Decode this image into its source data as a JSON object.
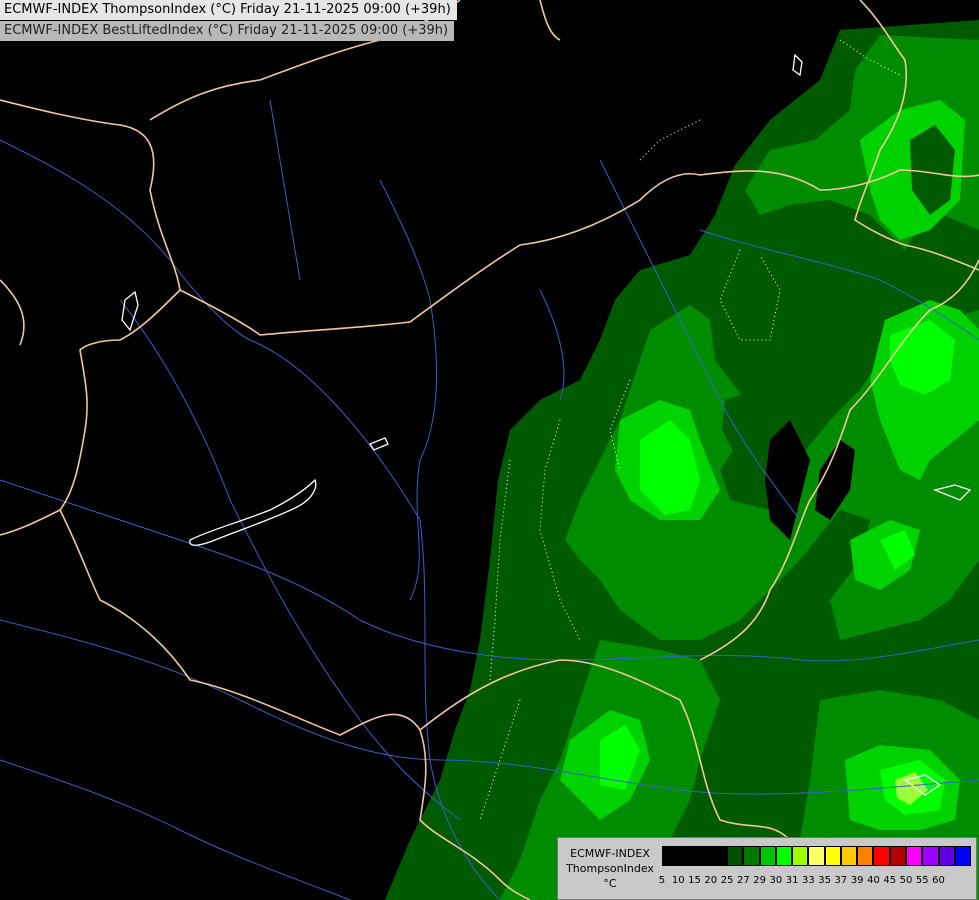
{
  "header": {
    "line1": "ECMWF-INDEX ThompsonIndex (°C) Friday 21-11-2025 09:00 (+39h)",
    "line2": "ECMWF-INDEX BestLiftedIndex (°C) Friday 21-11-2025 09:00 (+39h)"
  },
  "legend": {
    "model": "ECMWF-INDEX",
    "parameter": "ThompsonIndex",
    "unit": "°C",
    "bins": [
      {
        "label": "5",
        "color": "#000000"
      },
      {
        "label": "10",
        "color": "#000000"
      },
      {
        "label": "15",
        "color": "#000000"
      },
      {
        "label": "20",
        "color": "#000000"
      },
      {
        "label": "25",
        "color": "#005000"
      },
      {
        "label": "27",
        "color": "#007800"
      },
      {
        "label": "29",
        "color": "#00c800"
      },
      {
        "label": "30",
        "color": "#00ff00"
      },
      {
        "label": "31",
        "color": "#a0ff00"
      },
      {
        "label": "33",
        "color": "#ffff66"
      },
      {
        "label": "35",
        "color": "#ffff00"
      },
      {
        "label": "37",
        "color": "#ffc800"
      },
      {
        "label": "39",
        "color": "#ff8000"
      },
      {
        "label": "40",
        "color": "#ff0000"
      },
      {
        "label": "45",
        "color": "#b40000"
      },
      {
        "label": "50",
        "color": "#ff00ff"
      },
      {
        "label": "55",
        "color": "#a000ff"
      },
      {
        "label": "60",
        "color": "#6000e0"
      },
      {
        "label": "",
        "color": "#0000ff"
      }
    ]
  },
  "map": {
    "background": "#000000",
    "border_color": "#f2c89a",
    "river_color": "#3a5fc8",
    "lake_color": "#ffffff",
    "isoline_color": "#ffffff"
  }
}
